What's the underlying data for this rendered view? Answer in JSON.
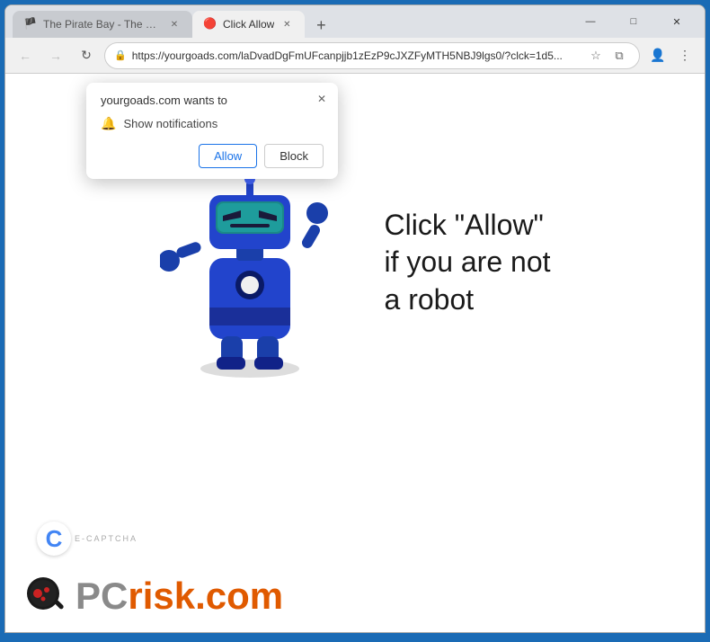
{
  "browser": {
    "title": "Browser Window",
    "tabs": [
      {
        "id": "tab-piratebay",
        "title": "The Pirate Bay - The galaxy's mo...",
        "favicon": "🏴",
        "active": false
      },
      {
        "id": "tab-clickallow",
        "title": "Click Allow",
        "favicon": "🔴",
        "active": true
      }
    ],
    "new_tab_label": "+",
    "window_controls": {
      "minimize": "—",
      "maximize": "□",
      "close": "✕"
    },
    "nav": {
      "back_label": "←",
      "forward_label": "→",
      "refresh_label": "↻",
      "address": "https://yourgoads.com/laDvadDgFmUFcanpjjb1zEzP9cJXZFyMTH5NBJ9lgs0/?clck=1d5...",
      "bookmark_label": "☆",
      "split_label": "⧉",
      "profile_label": "👤",
      "menu_label": "⋮"
    }
  },
  "notification_popup": {
    "title": "yourgoads.com wants to",
    "close_label": "✕",
    "notification_text": "Show notifications",
    "allow_label": "Allow",
    "block_label": "Block"
  },
  "page": {
    "click_text": "Click \"Allow\"\nif you are not\na robot",
    "ecaptcha_label": "E-CAPTCHA",
    "ecaptcha_letter": "C"
  },
  "pcrisk": {
    "pc_text": "PC",
    "risk_text": "risk.com"
  }
}
